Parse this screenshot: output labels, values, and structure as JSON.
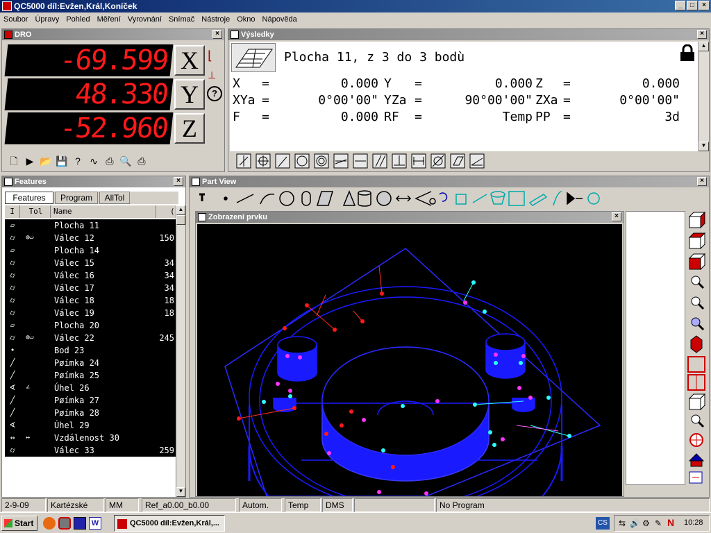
{
  "window": {
    "title": "QC5000 díl:Evžen,Král,Koníček"
  },
  "menu": [
    "Soubor",
    "Úpravy",
    "Pohled",
    "Měření",
    "Vyrovnání",
    "Snímač",
    "Nástroje",
    "Okno",
    "Nápověda"
  ],
  "dro": {
    "title": "DRO",
    "rows": [
      {
        "value": "-69.599",
        "axis": "X"
      },
      {
        "value": "48.330",
        "axis": "Y"
      },
      {
        "value": "-52.960",
        "axis": "Z"
      }
    ]
  },
  "results": {
    "title": "Výsledky",
    "heading": "Plocha 11, z 3 do 3 bodù",
    "lines": [
      [
        "X",
        "=",
        "0.000",
        "Y",
        "=",
        "0.000",
        "Z",
        "=",
        "0.000"
      ],
      [
        "XYa",
        "=",
        "0°00'00\"",
        "YZa",
        "=",
        "90°00'00\"",
        "ZXa",
        "=",
        "0°00'00\""
      ],
      [
        "F",
        "=",
        "0.000",
        "RF",
        "=",
        "Temp",
        "PP",
        "=",
        "3d"
      ]
    ]
  },
  "features": {
    "title": "Features",
    "tabs": [
      "Features",
      "Program",
      "AllTol"
    ],
    "columns": [
      "I",
      "Tol",
      "Name",
      "("
    ],
    "items": [
      {
        "icon": "plane",
        "tol": "",
        "name": "Plocha 11",
        "count": ""
      },
      {
        "icon": "cylinder",
        "tol": "pos-flat",
        "name": "Válec 12",
        "count": "150"
      },
      {
        "icon": "plane",
        "tol": "",
        "name": "Plocha 14",
        "count": ""
      },
      {
        "icon": "cylinder",
        "tol": "",
        "name": "Válec 15",
        "count": "34"
      },
      {
        "icon": "cylinder",
        "tol": "",
        "name": "Válec 16",
        "count": "34"
      },
      {
        "icon": "cylinder",
        "tol": "",
        "name": "Válec 17",
        "count": "34"
      },
      {
        "icon": "cylinder",
        "tol": "",
        "name": "Válec 18",
        "count": "18"
      },
      {
        "icon": "cylinder",
        "tol": "",
        "name": "Válec 19",
        "count": "18"
      },
      {
        "icon": "plane",
        "tol": "",
        "name": "Plocha 20",
        "count": ""
      },
      {
        "icon": "cylinder",
        "tol": "pos-flat",
        "name": "Válec 22",
        "count": "245"
      },
      {
        "icon": "point",
        "tol": "",
        "name": "Bod 23",
        "count": ""
      },
      {
        "icon": "line",
        "tol": "",
        "name": "Pøímka 24",
        "count": ""
      },
      {
        "icon": "line",
        "tol": "",
        "name": "Pøímka 25",
        "count": ""
      },
      {
        "icon": "angle",
        "tol": "angle",
        "name": "Úhel 26",
        "count": ""
      },
      {
        "icon": "line",
        "tol": "",
        "name": "Pøímka 27",
        "count": ""
      },
      {
        "icon": "line",
        "tol": "",
        "name": "Pøímka 28",
        "count": ""
      },
      {
        "icon": "angle",
        "tol": "",
        "name": "Úhel 29",
        "count": ""
      },
      {
        "icon": "distance",
        "tol": "distance",
        "name": "Vzdálenost 30",
        "count": ""
      },
      {
        "icon": "cylinder",
        "tol": "",
        "name": "Válec 33",
        "count": "259"
      }
    ]
  },
  "partview": {
    "title": "Part View",
    "subtitle": "Zobrazení prvku"
  },
  "status": [
    "2-9-09",
    "Kartézské",
    "MM",
    "Ref_a0.00_b0.00",
    "Autom.",
    "Temp",
    "DMS",
    "",
    "No Program"
  ],
  "taskbar": {
    "start": "Start",
    "task": "QC5000 díl:Evžen,Král,...",
    "tray_lang": "CS",
    "clock": "10:28"
  },
  "colors": {
    "dro_digit": "#ff1a1a",
    "view_bg": "#000000",
    "part": "#1a1aff",
    "title_active": "#0a246a"
  }
}
